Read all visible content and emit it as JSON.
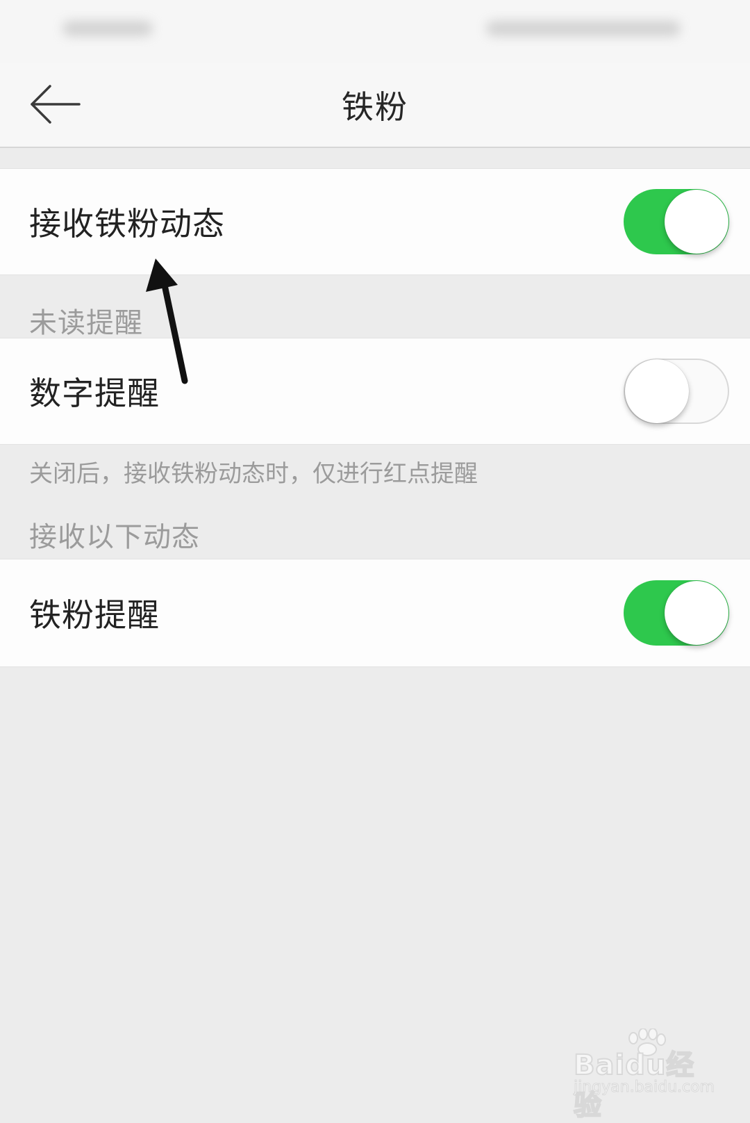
{
  "nav": {
    "title": "铁粉",
    "back_icon": "arrow-left-icon"
  },
  "settings": {
    "receive_dynamics": {
      "label": "接收铁粉动态",
      "enabled": true
    },
    "unread_section": "未读提醒",
    "number_reminder": {
      "label": "数字提醒",
      "enabled": false
    },
    "note": "关闭后，接收铁粉动态时，仅进行红点提醒",
    "receive_section": "接收以下动态",
    "fan_reminder": {
      "label": "铁粉提醒",
      "enabled": true
    }
  },
  "colors": {
    "toggle_on": "#2ec84d",
    "background": "#ececec"
  },
  "watermark": {
    "brand": "Baidu经验",
    "url": "jingyan.baidu.com"
  }
}
